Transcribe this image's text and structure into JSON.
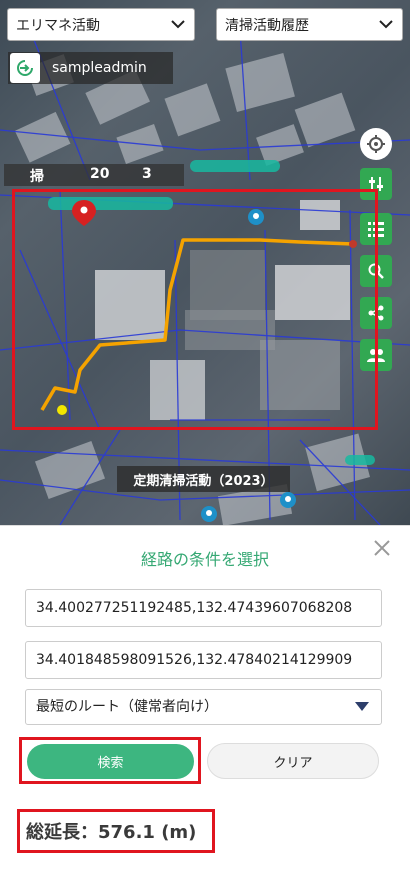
{
  "header": {
    "activity_select": "エリマネ活動",
    "history_select": "清掃活動履歴"
  },
  "user": {
    "name": "sampleadmin",
    "logout_icon": "logout-icon"
  },
  "stats": {
    "label": "掃",
    "count": "20",
    "number": "3"
  },
  "map": {
    "activity_label": "定期清掃活動（2023）",
    "route_color": "#f5a300",
    "frame_color": "#e0151f",
    "controls": [
      "locate-icon",
      "layers-icon",
      "list-icon",
      "search-icon",
      "share-icon",
      "group-icon"
    ]
  },
  "panel": {
    "title": "経路の条件を選択",
    "start_coord": "34.400277251192485,132.47439607068208",
    "end_coord": "34.401848598091526,132.47840214129909",
    "route_type": "最短のルート（健常者向け）",
    "search_label": "検索",
    "clear_label": "クリア",
    "total_label": "総延長：576.1 (m)",
    "accent_color": "#3db680"
  }
}
